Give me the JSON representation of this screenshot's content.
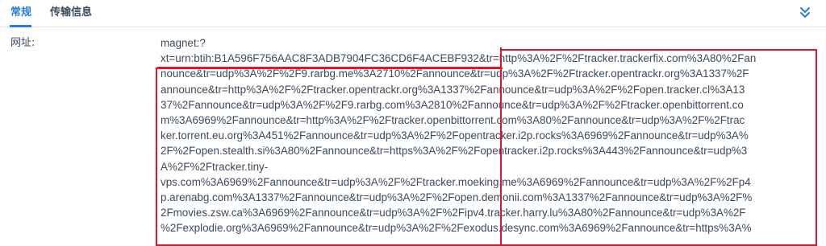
{
  "tabs": [
    {
      "label": "常规",
      "active": true
    },
    {
      "label": "传输信息",
      "active": false
    }
  ],
  "collapse_icon": "double-chevron-down-icon",
  "field": {
    "label": "网址:",
    "value_lines": [
      "magnet:?",
      "xt=urn:btih:B1A596F756AAC8F3ADB7904FC36CD6F4ACEBF932&tr=http%3A%2F%2Ftracker.trackerfix.com%3A80%2Fan",
      "nounce&tr=udp%3A%2F%2F9.rarbg.me%3A2710%2Fannounce&tr=udp%3A%2F%2Ftracker.opentrackr.org%3A1337%2F",
      "announce&tr=http%3A%2F%2Ftracker.opentrackr.org%3A1337%2Fannounce&tr=udp%3A%2F%2Fopen.tracker.cl%3A13",
      "37%2Fannounce&tr=udp%3A%2F%2F9.rarbg.com%3A2810%2Fannounce&tr=udp%3A%2F%2Ftracker.openbittorrent.co",
      "m%3A6969%2Fannounce&tr=http%3A%2F%2Ftracker.openbittorrent.com%3A80%2Fannounce&tr=udp%3A%2F%2Ftrac",
      "ker.torrent.eu.org%3A451%2Fannounce&tr=udp%3A%2F%2Fopentracker.i2p.rocks%3A6969%2Fannounce&tr=udp%3A%",
      "2F%2Fopen.stealth.si%3A80%2Fannounce&tr=https%3A%2F%2Fopentracker.i2p.rocks%3A443%2Fannounce&tr=udp%3",
      "A%2F%2Ftracker.tiny-",
      "vps.com%3A6969%2Fannounce&tr=udp%3A%2F%2Ftracker.moeking.me%3A6969%2Fannounce&tr=udp%3A%2F%2Fp4",
      "p.arenabg.com%3A1337%2Fannounce&tr=udp%3A%2F%2Fopen.demonii.com%3A1337%2Fannounce&tr=udp%3A%2F%",
      "2Fmovies.zsw.ca%3A6969%2Fannounce&tr=udp%3A%2F%2Fipv4.tracker.harry.lu%3A80%2Fannounce&tr=udp%3A%2F",
      "%2Fexplodie.org%3A6969%2Fannounce&tr=udp%3A%2F%2Fexodus.desync.com%3A6969%2Fannounce&tr=https%3A%"
    ]
  },
  "colors": {
    "accent": "#2a7bd8",
    "highlight": "#e3132b",
    "text": "#3d4a5c",
    "divider": "#e3e7ec"
  }
}
